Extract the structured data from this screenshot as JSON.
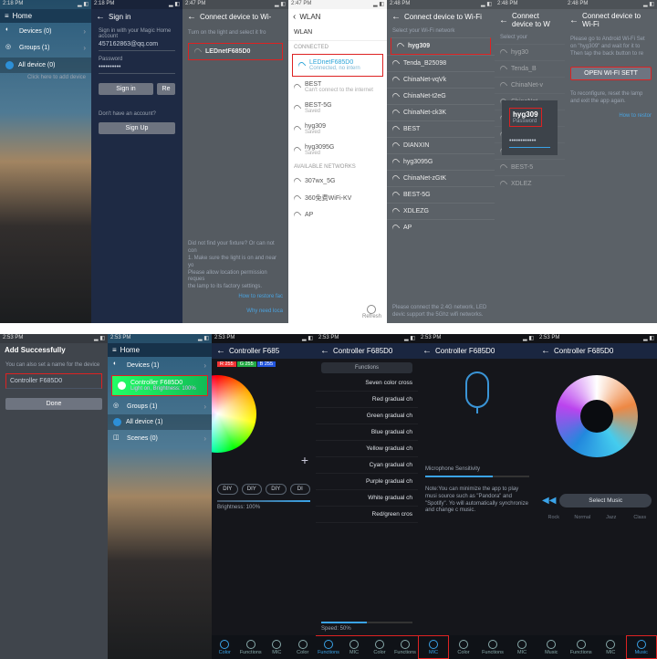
{
  "row1": {
    "p1": {
      "time": "2:18 PM",
      "header": "Home",
      "items": [
        "Devices (0)",
        "Groups (1)"
      ],
      "all_device": "All device (0)",
      "hint": "Click here to add device"
    },
    "p2": {
      "time": "2:18 PM",
      "header": "Sign in",
      "sub": "Sign in with your Magic Home account",
      "email": "457162863@qq.com",
      "pwd_label": "Password",
      "pwd": "••••••••••",
      "signin": "Sign in",
      "reset": "Re",
      "noacct": "Don't have an account?",
      "signup": "Sign Up"
    },
    "p3": {
      "time": "2:47 PM",
      "header": "Connect device to Wi-",
      "instr": "Turn on the light and select it fro",
      "device": "LEDnetF685D0",
      "trouble": [
        "Did not find your fixture? Or can not con",
        "1. Make sure the light is on and near yo",
        "Please allow location permission reques",
        "the lamp to its factory settings."
      ],
      "restore": "How to restore fac",
      "loc": "Why need loca"
    },
    "p4": {
      "time": "2:47 PM",
      "header": "WLAN",
      "wlan": "WLAN",
      "connected": "CONNECTED",
      "connected_net": "LEDnetF685D0",
      "connected_sub": "Connected, no intern",
      "nets": [
        {
          "n": "BEST",
          "s": "Can't connect to the internet"
        },
        {
          "n": "BEST-5G",
          "s": "Saved"
        },
        {
          "n": "hyg309",
          "s": "Saved"
        },
        {
          "n": "hyg3095G",
          "s": "Saved"
        }
      ],
      "avail": "AVAILABLE NETWORKS",
      "avail_nets": [
        "307wx_5G",
        "360免费WiFi-KV",
        "AP"
      ],
      "refresh": "Refresh"
    },
    "p5": {
      "time": "2:48 PM",
      "header": "Connect device to Wi-Fi",
      "sub": "Select your Wi-Fi network",
      "nets": [
        "hyg309",
        "Tenda_B25098",
        "ChinaNet-vqVk",
        "ChinaNet-t2eG",
        "ChinaNet-ck3K",
        "BEST",
        "DIANXIN",
        "hyg3095G",
        "ChinaNet-zGtK",
        "BEST-5G",
        "XDLEZG",
        "AP"
      ],
      "note": "Please connect the 2.4G network, LED devic support the 5Ghz wifi networks."
    },
    "p6": {
      "time": "2:48 PM",
      "header": "Connect device to W",
      "sub": "Select your",
      "nets": [
        "hyg30",
        "Tenda_B",
        "ChinaNet-v",
        "ChinaNet-",
        "ChinaNet-",
        "hyg",
        "ChinaNet-z",
        "BEST-5",
        "XDLEZ"
      ],
      "popup_title": "hyg309",
      "popup_sub": "Password",
      "popup_field": "••••••••••••"
    },
    "p7": {
      "time": "2:48 PM",
      "header": "Connect device to Wi-Fi",
      "text": [
        "Please go to Android Wi-Fi Set",
        "on \"hyg309\" and wait for it to",
        "Then tap the back button to re"
      ],
      "open": "OPEN WI-FI SETT",
      "reconf": [
        "To reconfigure, reset the lamp",
        "and exit the app again."
      ],
      "restore": "How to restor"
    }
  },
  "row2": {
    "p1": {
      "time": "2:53 PM",
      "header": "Add Successfully",
      "sub": "You can also set a name for the device",
      "name": "Controller  F685D0",
      "done": "Done"
    },
    "p2": {
      "time": "2:53 PM",
      "header": "Home",
      "devices": "Devices (1)",
      "dev_name": "Controller  F685D0",
      "dev_sub": "Light on, Brightness: 100%",
      "groups": "Groups (1)",
      "all": "All device (1)",
      "scenes": "Scenes (0)"
    },
    "p3": {
      "time": "2:53 PM",
      "header": "Controller  F685",
      "r": "R 255",
      "g": "G 255",
      "b": "B 255",
      "diy": [
        "DIY",
        "DIY",
        "DIY",
        "DI"
      ],
      "bright": "Brightness: 100%",
      "tabs": [
        "Color",
        "Functions",
        "MIC",
        "Color"
      ]
    },
    "p4": {
      "time": "2:53 PM",
      "header": "Controller  F685D0",
      "funcbar": "Functions",
      "items": [
        "Seven color cross",
        "Red gradual ch",
        "Green gradual ch",
        "Blue gradual ch",
        "Yellow gradual ch",
        "Cyan gradual ch",
        "Purple gradual ch",
        "White gradual ch",
        "Red/green cros"
      ],
      "speed": "Speed: 50%",
      "tabs": [
        "Functions",
        "MIC",
        "Color",
        "Functions"
      ]
    },
    "p5": {
      "time": "2:53 PM",
      "header": "Controller  F685D0",
      "sens": "Microphone Sensitivity",
      "note": "Note:You can minimize the app to play musi source such as \"Pandora\" and \"Spotify\". Yo will automatically synchronize and change c music.",
      "tabs": [
        "MIC",
        "Color",
        "Functions",
        "MIC"
      ]
    },
    "p6": {
      "time": "2:53 PM",
      "header": "Controller  F685D0",
      "select": "Select Music",
      "genres": [
        "Rock",
        "Normal",
        "Jazz",
        "Class"
      ],
      "tabs": [
        "Music",
        "Functions",
        "MIC",
        "Music"
      ]
    }
  },
  "tab_labels": {
    "color": "Color",
    "func": "Functions",
    "mic": "MIC",
    "music": "Music"
  }
}
